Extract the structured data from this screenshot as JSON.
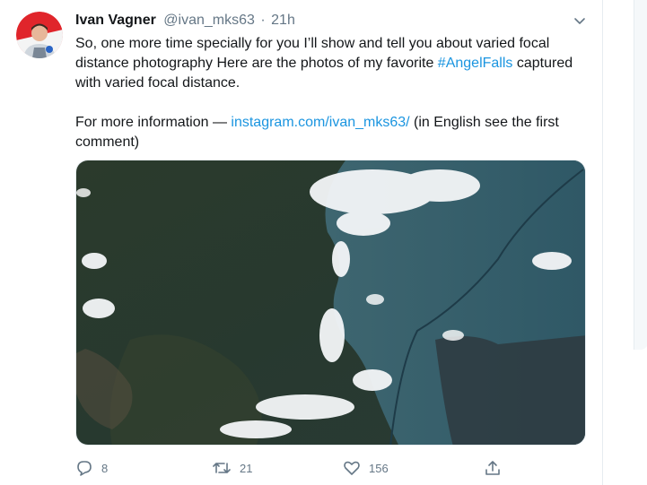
{
  "tweet": {
    "author_name": "Ivan Vagner",
    "author_handle": "@ivan_mks63",
    "separator": "·",
    "time": "21h",
    "text_line1": "So, one more time specially for you I’ll show and tell you about varied focal distance photography Here are the photos of my favorite ",
    "hashtag": "#AngelFalls",
    "text_line1_end": " captured with varied focal distance.",
    "text_line2_start": "For more information — ",
    "link": "instagram.com/ivan_mks63/",
    "text_line2_end": " (in English see the first comment)"
  },
  "actions": {
    "reply_count": "8",
    "retweet_count": "21",
    "like_count": "156"
  },
  "icons": {
    "caret": "chevron-down-icon",
    "reply": "reply-icon",
    "retweet": "retweet-icon",
    "like": "heart-icon",
    "share": "share-icon"
  },
  "colors": {
    "accent": "#1b95e0",
    "muted": "#657786"
  }
}
